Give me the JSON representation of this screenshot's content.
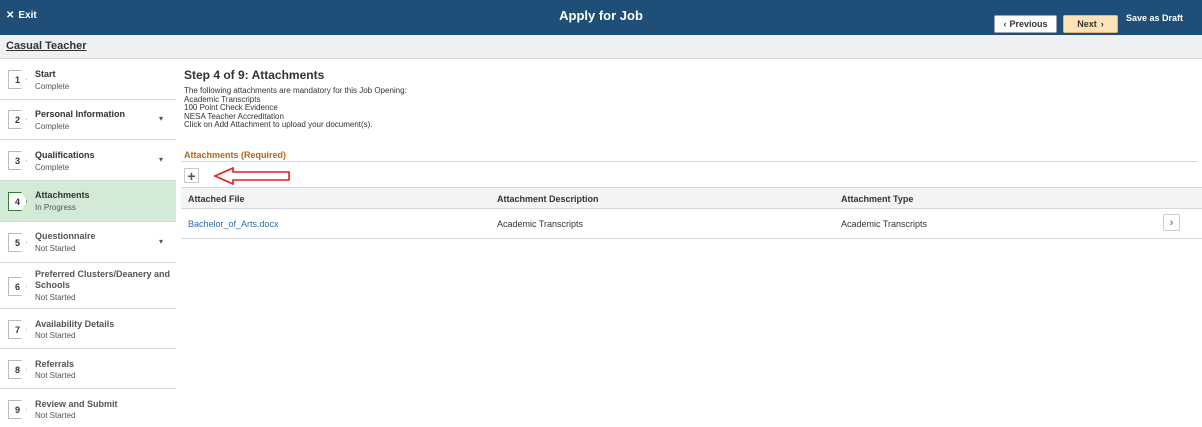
{
  "header": {
    "exit_icon": "close-icon",
    "exit_label": "Exit",
    "title": "Apply for Job",
    "previous_label": "Previous",
    "next_label": "Next",
    "save_label": "Save as Draft"
  },
  "subheader": {
    "job_title": "Casual Teacher"
  },
  "sidebar": {
    "steps": [
      {
        "number": "1",
        "name": "Start",
        "status": "Complete"
      },
      {
        "number": "2",
        "name": "Personal Information",
        "status": "Complete"
      },
      {
        "number": "3",
        "name": "Qualifications",
        "status": "Complete"
      },
      {
        "number": "4",
        "name": "Attachments",
        "status": "In Progress"
      },
      {
        "number": "5",
        "name": "Questionnaire",
        "status": "Not Started"
      },
      {
        "number": "6",
        "name": "Preferred Clusters/Deanery and Schools",
        "status": "Not Started"
      },
      {
        "number": "7",
        "name": "Availability Details",
        "status": "Not Started"
      },
      {
        "number": "8",
        "name": "Referrals",
        "status": "Not Started"
      },
      {
        "number": "9",
        "name": "Review and Submit",
        "status": "Not Started"
      }
    ]
  },
  "main": {
    "heading": "Step 4 of 9: Attachments",
    "intro_lines": [
      "The following attachments are mandatory for this Job Opening:",
      "Academic Transcripts",
      "100 Point Check Evidence",
      "NESA Teacher Accreditation",
      "Click on Add Attachment to upload your document(s)."
    ],
    "section_title": "Attachments (Required)",
    "add_label": "+",
    "table": {
      "columns": [
        "Attached File",
        "Attachment Description",
        "Attachment Type"
      ],
      "rows": [
        {
          "file": "Bachelor_of_Arts.docx",
          "description": "Academic Transcripts",
          "type": "Academic Transcripts"
        }
      ]
    }
  },
  "colors": {
    "header_bg": "#1f4e79",
    "next_button_bg": "#fde3b5",
    "active_step_bg": "#d3ead7",
    "section_title": "#b5651d",
    "link": "#2b6cb0",
    "annotation_arrow": "#e02020"
  }
}
